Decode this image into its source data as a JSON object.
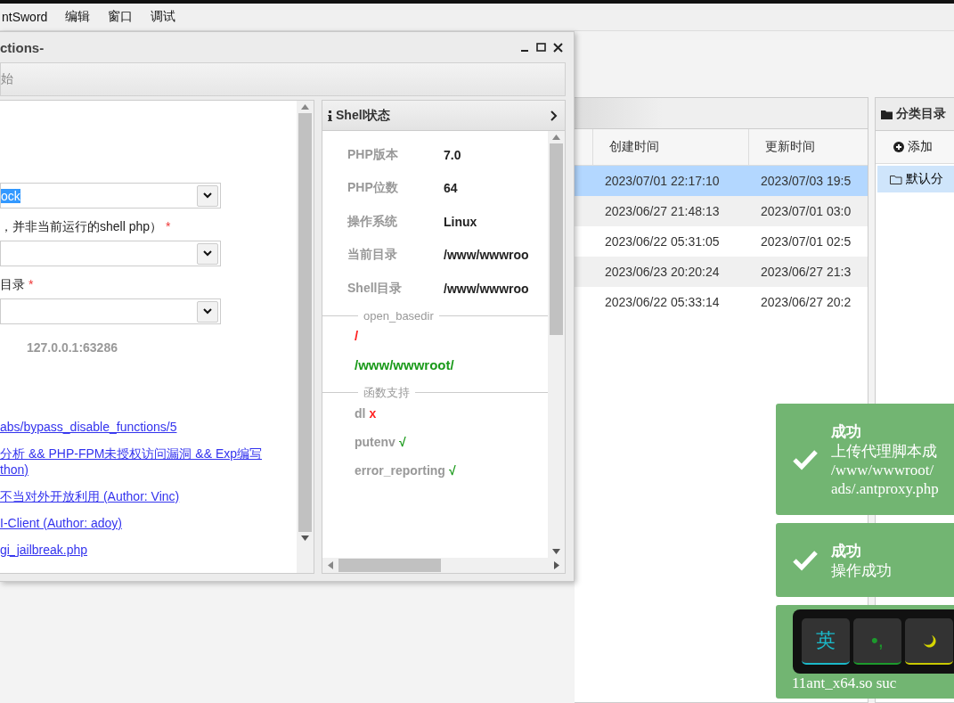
{
  "menu": [
    "ntSword",
    "编辑",
    "窗口",
    "调试"
  ],
  "dialog": {
    "title": "ctions-",
    "toolbar": [
      "始"
    ],
    "form": [
      {
        "kind": "select",
        "value": "ock",
        "highlighted": true
      },
      {
        "kind": "label",
        "text": "，并非当前运行的shell php）",
        "required_mark": "*"
      },
      {
        "kind": "select"
      },
      {
        "kind": "label",
        "text": "目录",
        "required_mark": "*"
      },
      {
        "kind": "select"
      },
      {
        "kind": "note",
        "text": "127.0.0.1:63286"
      }
    ],
    "links": [
      "abs/bypass_disable_functions/5",
      "分析 && PHP-FPM未授权访问漏洞 && Exp编写",
      "thon)",
      "不当对外开放利用 (Author: Vinc)",
      "I-Client (Author: adoy)",
      "gi_jailbreak.php"
    ],
    "shell_status": {
      "title": "Shell状态",
      "info": [
        {
          "key": "PHP版本",
          "value": "7.0"
        },
        {
          "key": "PHP位数",
          "value": "64"
        },
        {
          "key": "操作系统",
          "value": "Linux"
        },
        {
          "key": "当前目录",
          "value": "/www/wwwroo"
        },
        {
          "key": "Shell目录",
          "value": "/www/wwwroo"
        }
      ],
      "open_basedir": {
        "legend": "open_basedir",
        "paths": [
          {
            "text": "/",
            "allowed": false
          },
          {
            "text": "/www/wwwroot/",
            "allowed": true
          }
        ]
      },
      "functions": {
        "legend": "函数支持",
        "items": [
          {
            "name": "dl",
            "mark": "x",
            "supported": false
          },
          {
            "name": "putenv",
            "mark": "√",
            "supported": true
          },
          {
            "name": "error_reporting",
            "mark": "√",
            "supported": true
          }
        ]
      }
    }
  },
  "table": {
    "columns": [
      "创建时间",
      "更新时间"
    ],
    "rows": [
      {
        "created": "2023/07/01 22:17:10",
        "updated": "2023/07/03 19:5",
        "selected": true
      },
      {
        "created": "2023/06/27 21:48:13",
        "updated": "2023/07/01 03:0",
        "selected": false
      },
      {
        "created": "2023/06/22 05:31:05",
        "updated": "2023/07/01 02:5",
        "selected": false
      },
      {
        "created": "2023/06/23 20:20:24",
        "updated": "2023/06/27 21:3",
        "selected": false
      },
      {
        "created": "2023/06/22 05:33:14",
        "updated": "2023/06/27 20:2",
        "selected": false
      }
    ]
  },
  "categories": {
    "title": "分类目录",
    "add": "添加",
    "items": [
      {
        "label": "默认分",
        "selected": true
      }
    ]
  },
  "toasts": [
    {
      "title": "成功",
      "lines": [
        "上传代理脚本成",
        "/www/wwwroot/",
        "ads/.antproxy.php"
      ]
    },
    {
      "title": "成功",
      "lines": [
        "操作成功"
      ]
    },
    {
      "lines": [
        "11ant_x64.so suc"
      ]
    }
  ],
  "ime": [
    {
      "kind": "text",
      "label": "英"
    },
    {
      "kind": "text",
      "label": "•,"
    },
    {
      "kind": "moon"
    }
  ]
}
